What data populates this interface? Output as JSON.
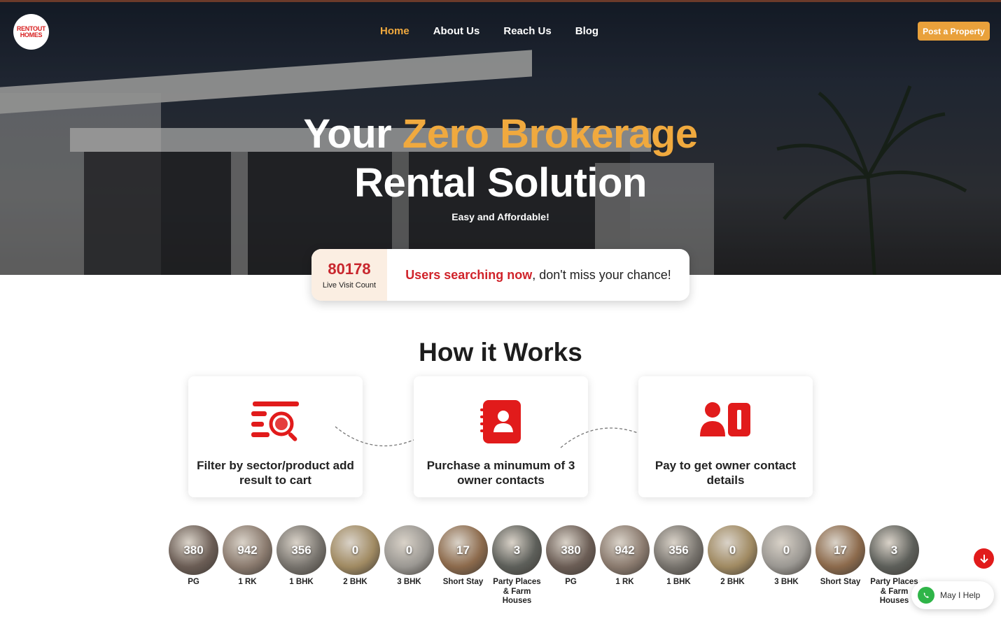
{
  "logo": {
    "line1": "RENTOUT",
    "line2": "HOMES"
  },
  "nav": [
    {
      "label": "Home",
      "active": true
    },
    {
      "label": "About Us",
      "active": false
    },
    {
      "label": "Reach Us",
      "active": false
    },
    {
      "label": "Blog",
      "active": false
    }
  ],
  "post_property_label": "Post a Property",
  "hero": {
    "title_white_1": "Your ",
    "title_accent": "Zero Brokerage",
    "title_line2": "Rental Solution",
    "tagline": "Easy and Affordable!"
  },
  "live": {
    "count": "80178",
    "label": "Live Visit Count",
    "highlight": "Users searching now",
    "rest": ", don't miss your chance!"
  },
  "how": {
    "title": "How it Works",
    "steps": [
      {
        "icon": "filter-search-icon",
        "text": "Filter by sector/product add result to cart"
      },
      {
        "icon": "contacts-book-icon",
        "text": "Purchase a minumum of 3 owner contacts"
      },
      {
        "icon": "owner-contact-icon",
        "text": "Pay to get owner contact details"
      }
    ]
  },
  "categories": [
    {
      "count": "380",
      "label": "PG",
      "tone": "#6b5d55"
    },
    {
      "count": "942",
      "label": "1 RK",
      "tone": "#8a7a6e"
    },
    {
      "count": "356",
      "label": "1 BHK",
      "tone": "#77736d"
    },
    {
      "count": "0",
      "label": "2 BHK",
      "tone": "#a08a62"
    },
    {
      "count": "0",
      "label": "3 BHK",
      "tone": "#9a9792"
    },
    {
      "count": "17",
      "label": "Short Stay",
      "tone": "#8c6a4c"
    },
    {
      "count": "3",
      "label": "Party Places & Farm Houses",
      "tone": "#5d5f5a"
    },
    {
      "count": "380",
      "label": "PG",
      "tone": "#6b5d55"
    },
    {
      "count": "942",
      "label": "1 RK",
      "tone": "#8a7a6e"
    },
    {
      "count": "356",
      "label": "1 BHK",
      "tone": "#77736d"
    },
    {
      "count": "0",
      "label": "2 BHK",
      "tone": "#a08a62"
    },
    {
      "count": "0",
      "label": "3 BHK",
      "tone": "#9a9792"
    },
    {
      "count": "17",
      "label": "Short Stay",
      "tone": "#8c6a4c"
    },
    {
      "count": "3",
      "label": "Party Places & Farm Houses",
      "tone": "#5d5f5a"
    }
  ],
  "help_label": "May I Help",
  "colors": {
    "accent": "#f0a93e",
    "brand_red": "#e11b1b",
    "button": "#e9a13b"
  }
}
